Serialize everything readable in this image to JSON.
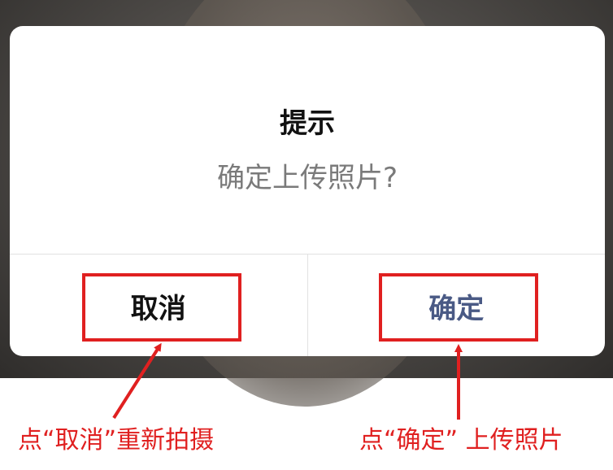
{
  "dialog": {
    "title": "提示",
    "message": "确定上传照片?",
    "cancel_label": "取消",
    "confirm_label": "确定"
  },
  "annotations": {
    "cancel_note": "点“取消”重新拍摄",
    "confirm_note": "点“确定” 上传照片"
  },
  "colors": {
    "highlight": "#e02020",
    "confirm_text": "#4a5a85",
    "message_text": "#7a7a7a"
  }
}
